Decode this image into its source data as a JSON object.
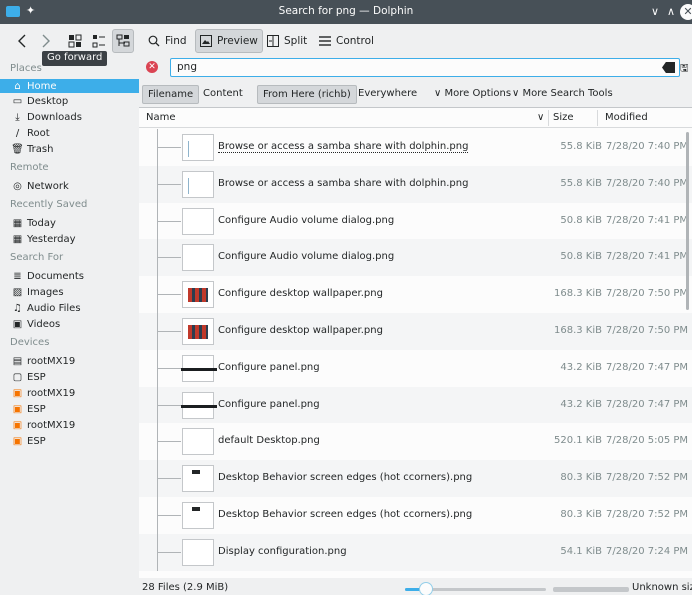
{
  "window": {
    "title": "Search for png — Dolphin"
  },
  "toolbar": {
    "find_label": "Find",
    "preview_label": "Preview",
    "split_label": "Split",
    "control_label": "Control",
    "tooltip": "Go forward"
  },
  "sidebar": {
    "places_header": "Places",
    "places": [
      {
        "label": "Home",
        "icon": "home-icon"
      },
      {
        "label": "Desktop",
        "icon": "desktop-icon"
      },
      {
        "label": "Downloads",
        "icon": "downloads-icon"
      },
      {
        "label": "Root",
        "icon": "root-icon"
      },
      {
        "label": "Trash",
        "icon": "trash-icon"
      }
    ],
    "remote_header": "Remote",
    "remote": [
      {
        "label": "Network",
        "icon": "network-icon"
      }
    ],
    "recent_header": "Recently Saved",
    "recent": [
      {
        "label": "Today",
        "icon": "calendar-icon"
      },
      {
        "label": "Yesterday",
        "icon": "calendar-icon"
      }
    ],
    "search_header": "Search For",
    "search": [
      {
        "label": "Documents",
        "icon": "documents-icon"
      },
      {
        "label": "Images",
        "icon": "images-icon"
      },
      {
        "label": "Audio Files",
        "icon": "audio-icon"
      },
      {
        "label": "Videos",
        "icon": "videos-icon"
      }
    ],
    "devices_header": "Devices",
    "devices": [
      {
        "label": "rootMX19",
        "icon": "drive-icon"
      },
      {
        "label": "ESP",
        "icon": "drive-icon"
      },
      {
        "label": "rootMX19",
        "icon": "drive-warning-icon"
      },
      {
        "label": "ESP",
        "icon": "drive-warning-icon"
      },
      {
        "label": "rootMX19",
        "icon": "drive-warning-icon"
      },
      {
        "label": "ESP",
        "icon": "drive-warning-icon"
      }
    ]
  },
  "search": {
    "query": "png"
  },
  "filters": {
    "filename": "Filename",
    "content": "Content",
    "from_here": "From Here (richb)",
    "everywhere": "Everywhere",
    "more_options": "More Options",
    "more_tools": "More Search Tools"
  },
  "columns": {
    "name": "Name",
    "size": "Size",
    "modified": "Modified"
  },
  "files": [
    {
      "name": "Browse or access a samba share with dolphin.png",
      "size": "55.8 KiB",
      "modified": "7/28/20 7:40 PM",
      "thumb": "dialog"
    },
    {
      "name": "Browse or access a samba share with dolphin.png",
      "size": "55.8 KiB",
      "modified": "7/28/20 7:40 PM",
      "thumb": "dialog"
    },
    {
      "name": "Configure Audio volume dialog.png",
      "size": "50.8 KiB",
      "modified": "7/28/20 7:41 PM",
      "thumb": "win"
    },
    {
      "name": "Configure Audio volume dialog.png",
      "size": "50.8 KiB",
      "modified": "7/28/20 7:41 PM",
      "thumb": "win"
    },
    {
      "name": "Configure desktop wallpaper.png",
      "size": "168.3 KiB",
      "modified": "7/28/20 7:50 PM",
      "thumb": "wall"
    },
    {
      "name": "Configure desktop wallpaper.png",
      "size": "168.3 KiB",
      "modified": "7/28/20 7:50 PM",
      "thumb": "wall"
    },
    {
      "name": "Configure panel.png",
      "size": "43.2 KiB",
      "modified": "7/28/20 7:47 PM",
      "thumb": "panel"
    },
    {
      "name": "Configure panel.png",
      "size": "43.2 KiB",
      "modified": "7/28/20 7:47 PM",
      "thumb": "panel"
    },
    {
      "name": "default Desktop.png",
      "size": "520.1 KiB",
      "modified": "7/28/20 5:05 PM",
      "thumb": "dark"
    },
    {
      "name": "Desktop Behavior screen edges (hot ccorners).png",
      "size": "80.3 KiB",
      "modified": "7/28/20 7:52 PM",
      "thumb": "edges"
    },
    {
      "name": "Desktop Behavior screen edges (hot ccorners).png",
      "size": "80.3 KiB",
      "modified": "7/28/20 7:52 PM",
      "thumb": "edges"
    },
    {
      "name": "Display configuration.png",
      "size": "54.1 KiB",
      "modified": "7/28/20 7:24 PM",
      "thumb": "display"
    }
  ],
  "status": {
    "count": "28 Files (2.9 MiB)",
    "space": "Unknown size",
    "zoom_level": 0.15
  },
  "colors": {
    "accent": "#3daee9",
    "titlebar": "#475057",
    "clear": "#da4453"
  }
}
